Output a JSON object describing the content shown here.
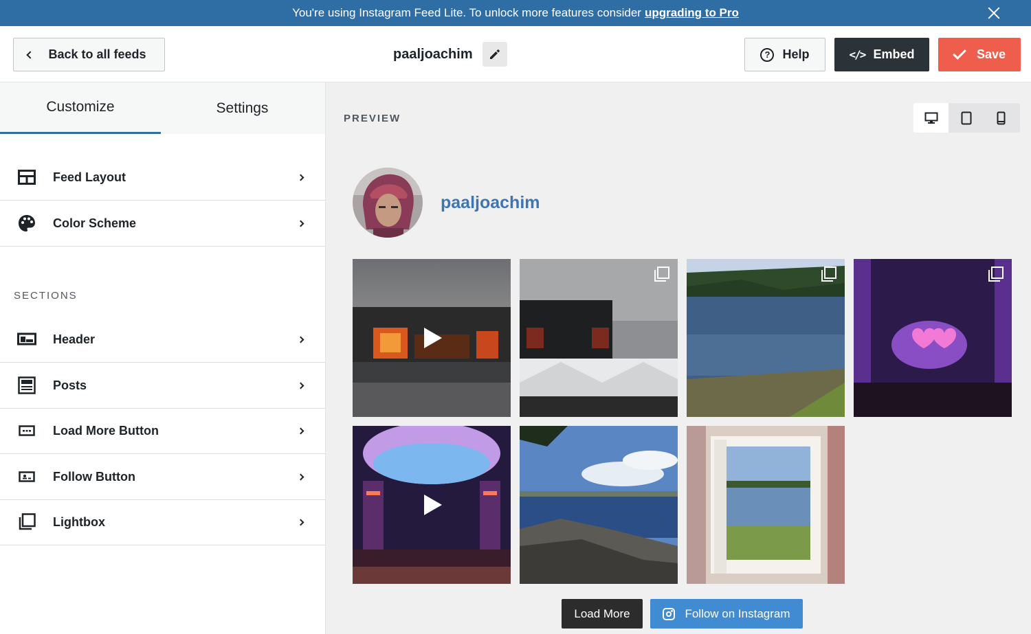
{
  "notice": {
    "text": "You're using Instagram Feed Lite. To unlock more features consider",
    "link": "upgrading to Pro"
  },
  "toolbar": {
    "back_label": "Back to all feeds",
    "feed_name": "paaljoachim",
    "help_label": "Help",
    "embed_label": "Embed",
    "save_label": "Save"
  },
  "sidebar": {
    "tabs": [
      {
        "label": "Customize",
        "active": true
      },
      {
        "label": "Settings",
        "active": false
      }
    ],
    "items": [
      {
        "label": "Feed Layout",
        "icon": "grid-layout-icon"
      },
      {
        "label": "Color Scheme",
        "icon": "palette-icon"
      }
    ],
    "sections_label": "SECTIONS",
    "sections": [
      {
        "label": "Header",
        "icon": "header-icon"
      },
      {
        "label": "Posts",
        "icon": "posts-icon"
      },
      {
        "label": "Load More Button",
        "icon": "load-more-icon"
      },
      {
        "label": "Follow Button",
        "icon": "follow-icon"
      },
      {
        "label": "Lightbox",
        "icon": "lightbox-icon"
      }
    ]
  },
  "preview": {
    "label": "PREVIEW",
    "devices": [
      "desktop-icon",
      "tablet-icon",
      "mobile-icon"
    ],
    "username": "paaljoachim",
    "posts": [
      {
        "type": "video",
        "scene": "concert-stage"
      },
      {
        "type": "carousel",
        "scene": "concert-stage-tents"
      },
      {
        "type": "carousel",
        "scene": "lake-forest"
      },
      {
        "type": "carousel",
        "scene": "purple-concert"
      },
      {
        "type": "video",
        "scene": "arena-show"
      },
      {
        "type": "image",
        "scene": "coast-rocks"
      },
      {
        "type": "image",
        "scene": "window-view"
      }
    ],
    "load_more_label": "Load More",
    "follow_label": "Follow on Instagram"
  },
  "colors": {
    "notice_bg": "#2f6da5",
    "embed_bg": "#2c3338",
    "save_bg": "#ef5d4d",
    "username": "#3d76b0",
    "follow_bg": "#408bd1",
    "load_more_bg": "#2c2c2c"
  }
}
